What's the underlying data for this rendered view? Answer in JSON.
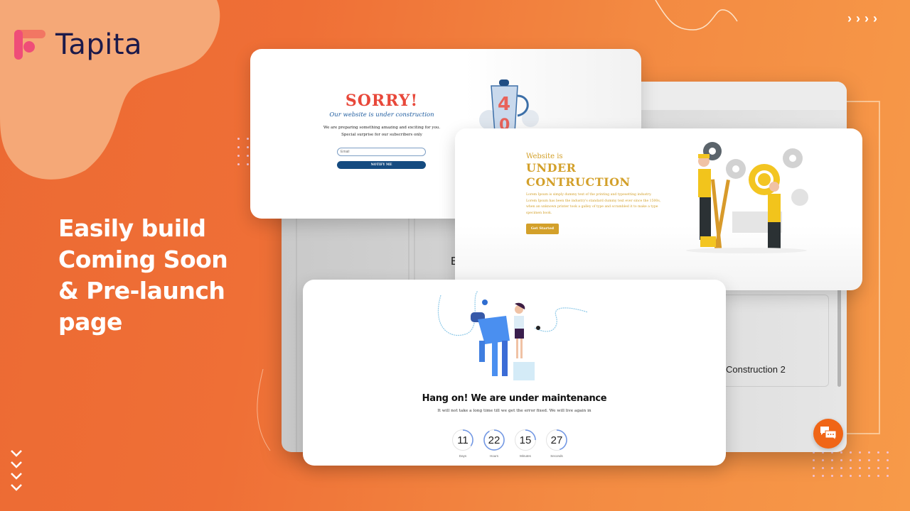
{
  "brand": {
    "name": "Tapita",
    "logo_icon": "tapita-logo-icon",
    "colors": {
      "primary_orange": "#ef6f36",
      "logo_pink": "#ef4d78",
      "logo_text": "#1c1a4a",
      "blob": "#f5a877"
    }
  },
  "headline": {
    "lines": [
      "Easily build",
      "Coming Soon",
      "& Pre-launch",
      "page"
    ]
  },
  "decor": {
    "arrows_right": [
      "›",
      "›",
      "›",
      "›"
    ],
    "arrows_down": [
      "⌄",
      "⌄",
      "⌄",
      "⌄"
    ]
  },
  "background_app": {
    "partial_label_left": "E",
    "panel_label": "Construction 2"
  },
  "card_sorry": {
    "title": "SORRY!",
    "subtitle": "Our website is under construction",
    "description_line1": "We are preparing something amazing and exciting for you.",
    "description_line2": "Special surprise for our subscribers only",
    "email_placeholder": "Email",
    "button_label": "NOTIFY ME",
    "illustration": "blender-404-icon",
    "colors": {
      "title": "#e8483a",
      "subtitle": "#215ea0",
      "button": "#154b80"
    }
  },
  "card_under_construction": {
    "pre_title": "Website is",
    "title_line1": "UNDER",
    "title_line2": "CONTRUCTION",
    "description": "Lorem Ipsum is simply dummy text of the printing and typesetting industry. Lorem Ipsum has been the industry's standard dummy text ever since the 1500s, when an unknown printer took a galley of type and scrambled it to make a type specimen book.",
    "button_label": "Get Started",
    "illustration": "construction-workers-gears-icon",
    "colors": {
      "accent": "#d3a02a"
    }
  },
  "card_maintenance": {
    "title": "Hang on! We are under maintenance",
    "subtitle": "It will not take a long time till we get the error fixed. We will live again in",
    "illustration": "robot-and-engineer-icon",
    "countdown": [
      {
        "value": "11",
        "label": "Days",
        "progress": 0.35
      },
      {
        "value": "22",
        "label": "Hours",
        "progress": 0.92
      },
      {
        "value": "15",
        "label": "Minutes",
        "progress": 0.25
      },
      {
        "value": "27",
        "label": "Seconds",
        "progress": 0.45
      }
    ],
    "colors": {
      "ring_progress": "#6f96e6"
    }
  },
  "chat": {
    "icon": "chat-bubbles-icon",
    "color": "#f06516"
  }
}
